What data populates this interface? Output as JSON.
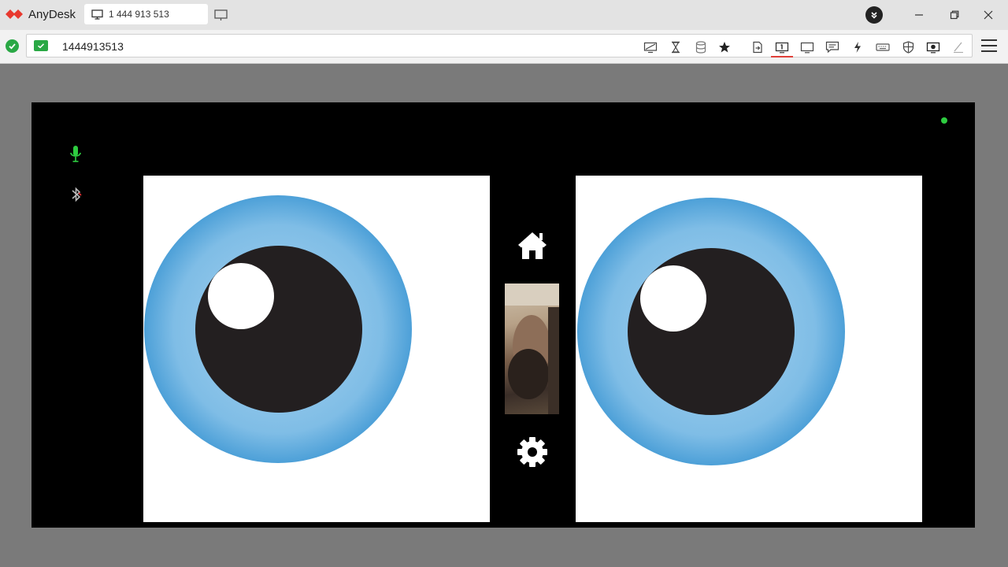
{
  "app": {
    "name": "AnyDesk",
    "brand_color": "#e8392f"
  },
  "tab": {
    "label": "1 444 913 513",
    "icon": "monitor-icon"
  },
  "address": {
    "value": "1444913513",
    "status_color": "#2aa845"
  },
  "toolbar": {
    "icons": [
      "display-settings-icon",
      "hourglass-icon",
      "database-icon",
      "star-icon",
      "file-transfer-icon",
      "monitor-one-icon",
      "monitor-icon",
      "chat-icon",
      "lightning-icon",
      "keyboard-icon",
      "shield-icon",
      "screen-record-icon",
      "pen-icon"
    ],
    "active": "monitor-one-icon",
    "active_color": "#e0403a"
  },
  "remote": {
    "background": "#000000",
    "status_color": "#2ecc40",
    "mic_color": "#2ecc40",
    "left_icons": [
      "microphone-icon",
      "bluetooth-off-icon"
    ],
    "nav_icons": [
      "home-icon",
      "settings-icon"
    ],
    "eye_colors": {
      "iris": "#0f78c3",
      "pupil": "#231f20",
      "glint": "#ffffff"
    }
  }
}
